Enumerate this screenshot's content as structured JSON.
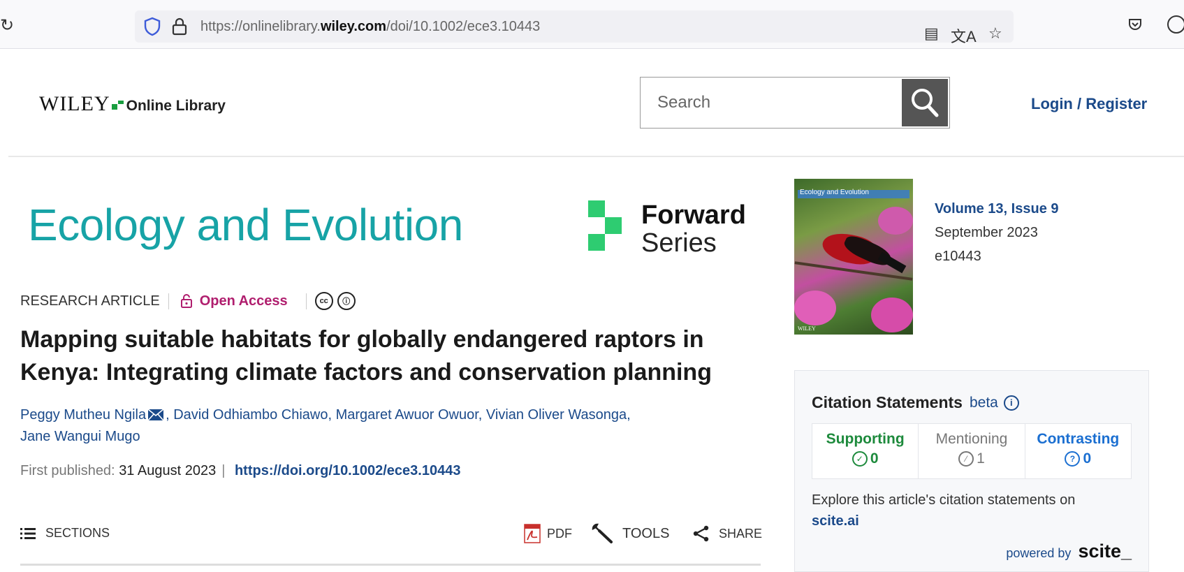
{
  "browser": {
    "url_prefix": "https://onlinelibrary.",
    "url_host": "wiley.com",
    "url_path": "/doi/10.1002/ece3.10443"
  },
  "header": {
    "logo_brand": "WILEY",
    "logo_product": "Online Library",
    "search_placeholder": "Search",
    "login_label": "Login / Register"
  },
  "journal": {
    "title": "Ecology and Evolution",
    "series_line1": "Forward",
    "series_line2": "Series",
    "cover_title": "Ecology and Evolution",
    "cover_publisher": "WILEY"
  },
  "issue": {
    "volume": "Volume 13, Issue 9",
    "date": "September 2023",
    "article_number": "e10443"
  },
  "article": {
    "type": "RESEARCH ARTICLE",
    "access": "Open Access",
    "license_icons": [
      "cc",
      "by"
    ],
    "title": "Mapping suitable habitats for globally endangered raptors in Kenya: Integrating climate factors and conservation planning",
    "authors": [
      "Peggy Mutheu Ngila",
      "David Odhiambo Chiawo",
      "Margaret Awuor Owuor",
      "Vivian Oliver Wasonga",
      "Jane Wangui Mugo"
    ],
    "first_published_label": "First published:",
    "first_published_date": "31 August 2023",
    "doi": "https://doi.org/10.1002/ece3.10443"
  },
  "toolbar": {
    "sections": "SECTIONS",
    "pdf": "PDF",
    "tools": "TOOLS",
    "share": "SHARE"
  },
  "citations": {
    "heading": "Citation Statements",
    "beta": "beta",
    "supporting_label": "Supporting",
    "supporting_count": "0",
    "mentioning_label": "Mentioning",
    "mentioning_count": "1",
    "contrasting_label": "Contrasting",
    "contrasting_count": "0",
    "explore_text": "Explore this article's citation statements on",
    "explore_link": "scite.ai",
    "powered_by": "powered by",
    "scite_brand": "scite_"
  },
  "colors": {
    "journal_teal": "#17a3a6",
    "link_blue": "#1b4a8a",
    "open_access": "#b01e6e",
    "supporting": "#1d8a3c",
    "contrasting": "#1b6fd1",
    "forward_green": "#2ecc71"
  }
}
